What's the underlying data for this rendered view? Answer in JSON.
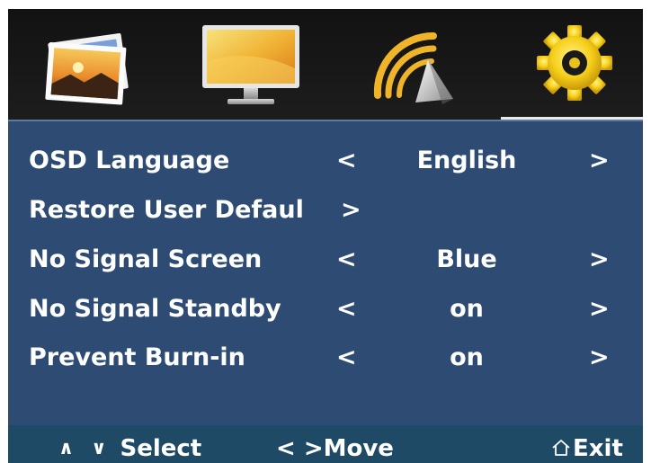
{
  "tabs": [
    {
      "icon": "picture-icon",
      "active": false
    },
    {
      "icon": "monitor-icon",
      "active": false
    },
    {
      "icon": "speaker-icon",
      "active": false
    },
    {
      "icon": "gear-icon",
      "active": true
    }
  ],
  "menu": {
    "rows": [
      {
        "label": "OSD Language",
        "left_arrow": "<",
        "value": "English",
        "right_arrow": ">"
      },
      {
        "label": "Restore User Defaul",
        "enter_arrow": ">"
      },
      {
        "label": "No Signal Screen",
        "left_arrow": "<",
        "value": "Blue",
        "right_arrow": ">"
      },
      {
        "label": "No Signal Standby",
        "left_arrow": "<",
        "value": "on",
        "right_arrow": ">"
      },
      {
        "label": "Prevent Burn-in",
        "left_arrow": "<",
        "value": "on",
        "right_arrow": ">"
      }
    ]
  },
  "help": {
    "updown_symbols": "∧ ∨",
    "select_label": "Select",
    "move_symbols": "< >",
    "move_label": "Move",
    "exit_icon": "home-icon",
    "exit_label": "Exit"
  },
  "colors": {
    "panel_bg": "#2e4b74",
    "tabbar_bg": "#121212",
    "helpbar_bg": "#1f4a66",
    "text": "#ffffff"
  }
}
